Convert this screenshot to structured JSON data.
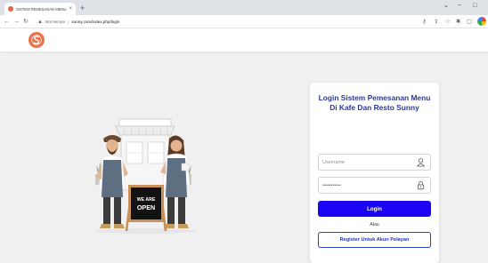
{
  "browser": {
    "tab_title": "SISTEM PEMESANAN MENU DI",
    "tab_close": "×",
    "new_tab": "+",
    "security_label": "Not secure",
    "url": "sunny.com/index.php/login",
    "win_minimize": "−",
    "win_restore": "□",
    "win_menu": "⌄"
  },
  "illustration": {
    "board_line1": "WE ARE",
    "board_line2": "OPEN"
  },
  "login": {
    "title": "Login Sistem Pemesanan Menu Di Kafe Dan Resto Sunny",
    "username_placeholder": "Username",
    "password_value": "•••••••••••",
    "login_button": "Login",
    "or_text": "Atau",
    "register_button": "Register Untuk Akun Pelayan"
  },
  "colors": {
    "title": "#2c3a96",
    "primary_button": "#1c05f5",
    "register_border": "#2d3fc2",
    "logo": "#e8734d"
  }
}
